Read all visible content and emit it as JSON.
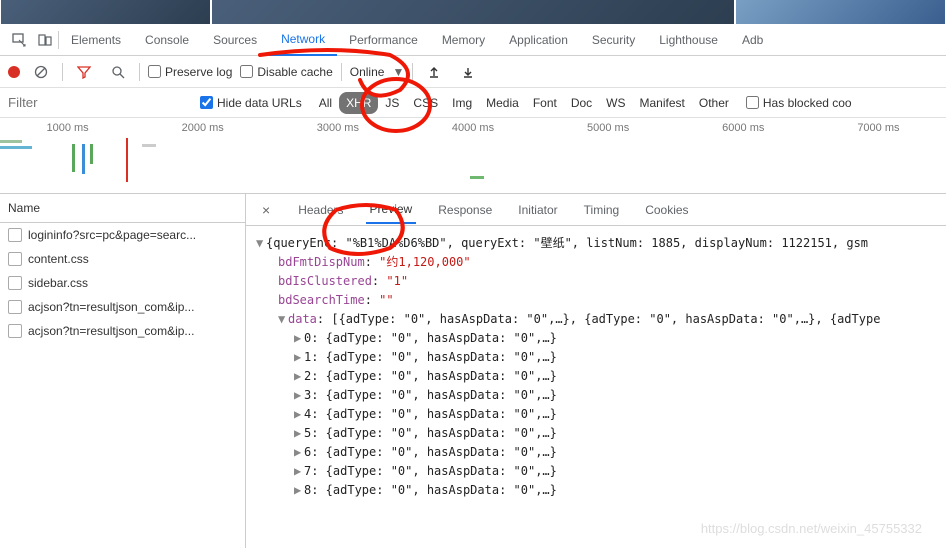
{
  "devtools_tabs": [
    "Elements",
    "Console",
    "Sources",
    "Network",
    "Performance",
    "Memory",
    "Application",
    "Security",
    "Lighthouse",
    "Adb"
  ],
  "devtools_active_tab": 3,
  "toolbar": {
    "preserve_log": "Preserve log",
    "disable_cache": "Disable cache",
    "online": "Online"
  },
  "filterbar": {
    "placeholder": "Filter",
    "hide_data_urls": "Hide data URLs",
    "types": [
      "All",
      "XHR",
      "JS",
      "CSS",
      "Img",
      "Media",
      "Font",
      "Doc",
      "WS",
      "Manifest",
      "Other"
    ],
    "active_type": "XHR",
    "has_blocked": "Has blocked coo"
  },
  "timeline": {
    "ticks": [
      "1000 ms",
      "2000 ms",
      "3000 ms",
      "4000 ms",
      "5000 ms",
      "6000 ms",
      "7000 ms"
    ]
  },
  "request_panel": {
    "header": "Name",
    "items": [
      "logininfo?src=pc&page=searc...",
      "content.css",
      "sidebar.css",
      "acjson?tn=resultjson_com&ip...",
      "acjson?tn=resultjson_com&ip..."
    ]
  },
  "detail_tabs": [
    "Headers",
    "Preview",
    "Response",
    "Initiator",
    "Timing",
    "Cookies"
  ],
  "detail_active": 1,
  "preview": {
    "root_line_before": "{queryEnc: \"",
    "root_enc": "%B1%DA%D6%BD",
    "root_line_mid": "\", queryExt: \"",
    "queryExt": "壁纸",
    "root_after": "\", listNum: 1885, displayNum: 1122151, gsm",
    "bdFmtDispNum_key": "bdFmtDispNum",
    "bdFmtDispNum_val": "\"约1,120,000\"",
    "bdIsClustered_key": "bdIsClustered",
    "bdIsClustered_val": "\"1\"",
    "bdSearchTime_key": "bdSearchTime",
    "bdSearchTime_val": "\"\"",
    "data_key": "data",
    "data_summary": "[{adType: \"0\", hasAspData: \"0\",…}, {adType: \"0\", hasAspData: \"0\",…}, {adType",
    "rows": [
      "0: {adType: \"0\", hasAspData: \"0\",…}",
      "1: {adType: \"0\", hasAspData: \"0\",…}",
      "2: {adType: \"0\", hasAspData: \"0\",…}",
      "3: {adType: \"0\", hasAspData: \"0\",…}",
      "4: {adType: \"0\", hasAspData: \"0\",…}",
      "5: {adType: \"0\", hasAspData: \"0\",…}",
      "6: {adType: \"0\", hasAspData: \"0\",…}",
      "7: {adType: \"0\", hasAspData: \"0\",…}",
      "8: {adType: \"0\", hasAspData: \"0\",…}"
    ]
  },
  "watermark": "https://blog.csdn.net/weixin_45755332"
}
